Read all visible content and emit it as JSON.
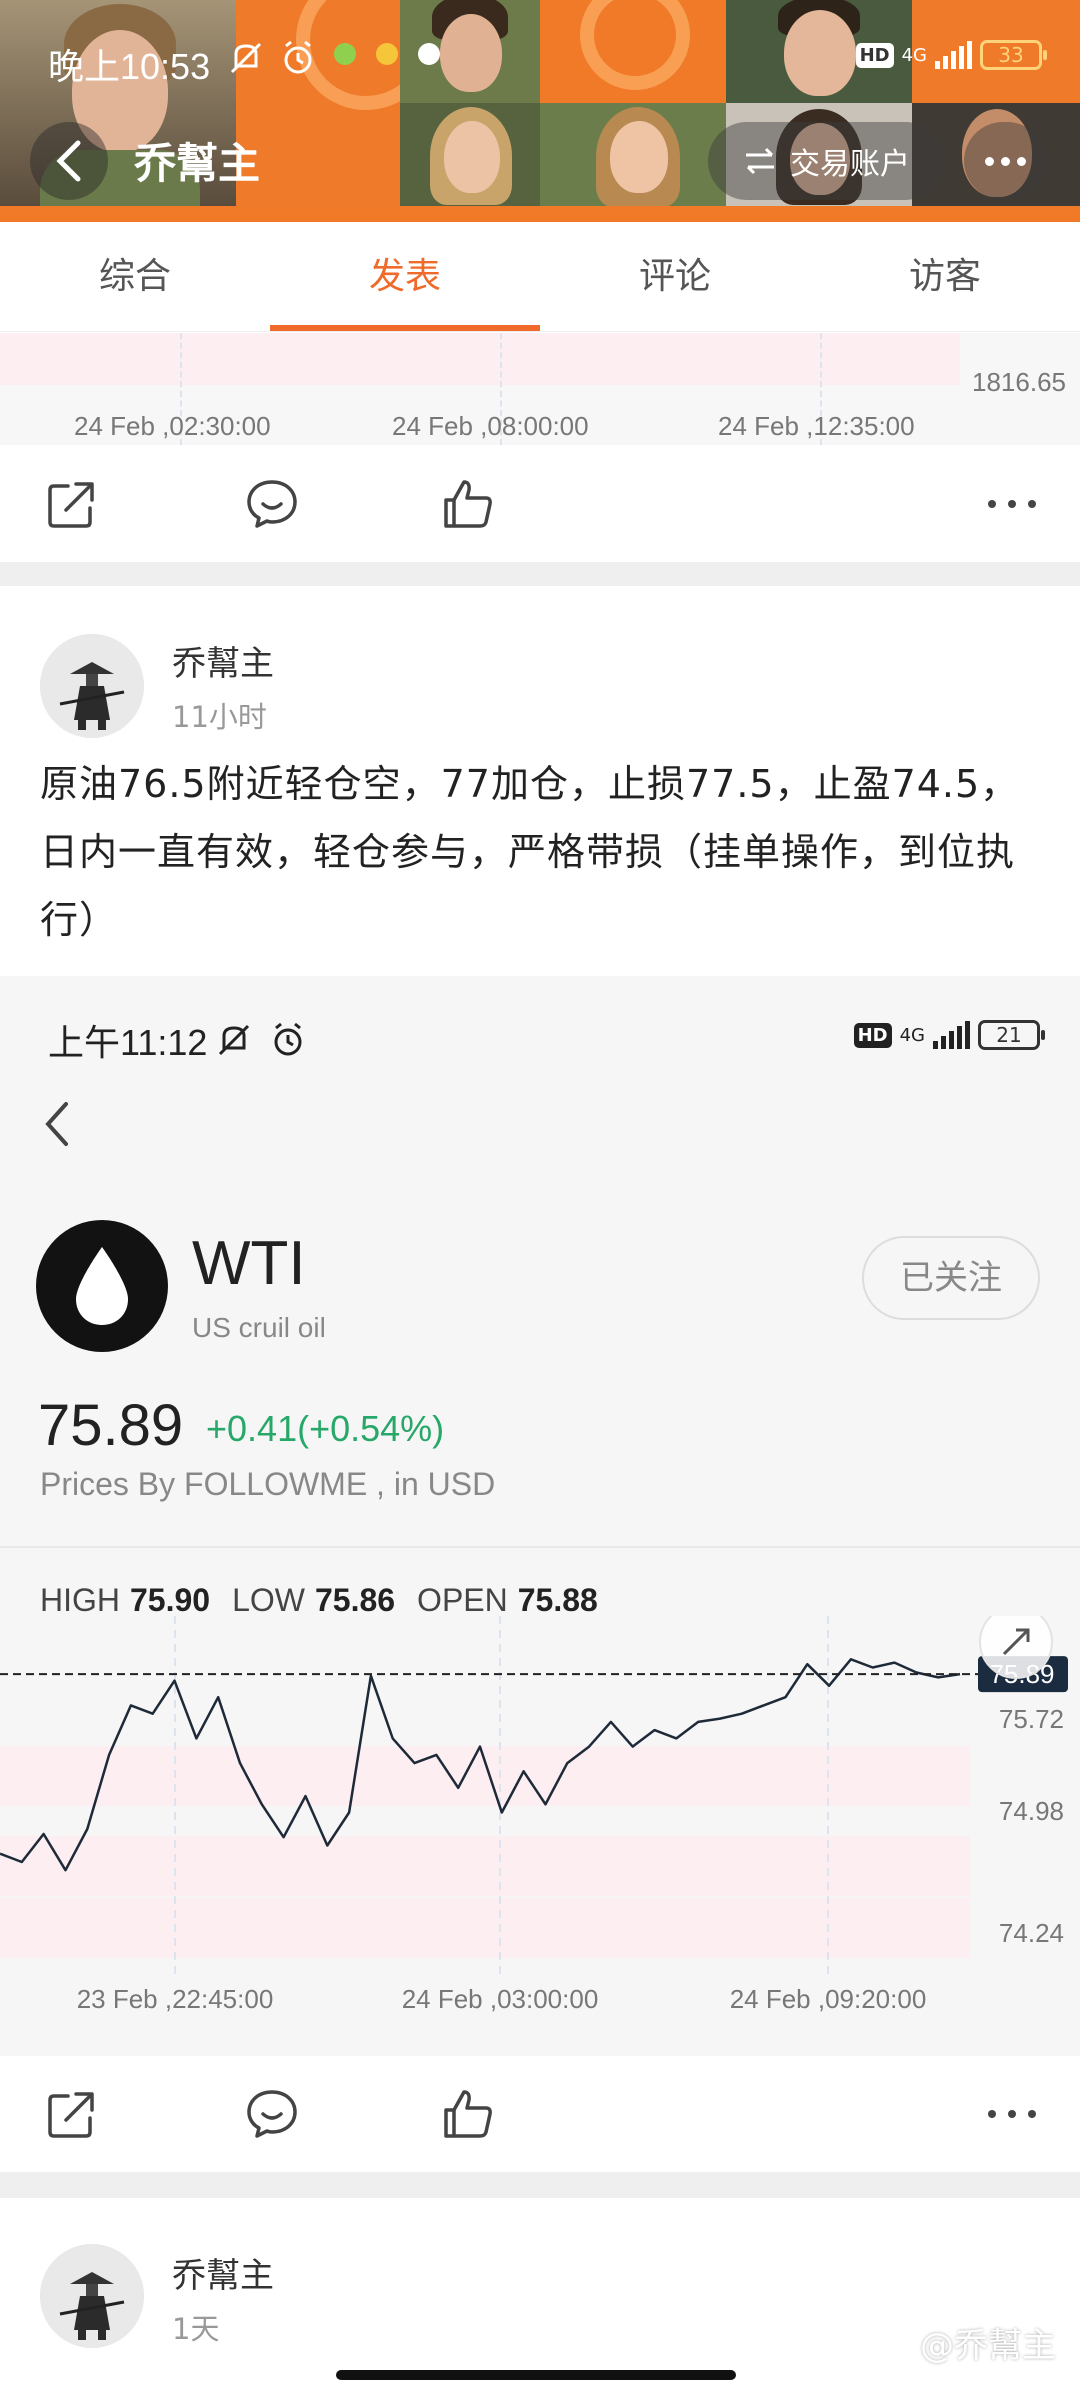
{
  "status_bar": {
    "time": "晚上10:53",
    "network": "4G",
    "battery": "33"
  },
  "nav": {
    "title": "乔幫主",
    "account_button": "交易账户"
  },
  "tabs": [
    {
      "label": "综合",
      "active": false
    },
    {
      "label": "发表",
      "active": true
    },
    {
      "label": "评论",
      "active": false
    },
    {
      "label": "访客",
      "active": false
    }
  ],
  "top_chart": {
    "y_label": "1816.65",
    "x_labels": [
      "24 Feb ,02:30:00",
      "24 Feb ,08:00:00",
      "24 Feb ,12:35:00"
    ]
  },
  "post": {
    "author": "乔幫主",
    "time": "11小时",
    "text": "原油76.5附近轻仓空，77加仓，止损77.5，止盈74.5，日内一直有效，轻仓参与，严格带损（挂单操作，到位执行）"
  },
  "embedded": {
    "status_time": "上午11:12",
    "network": "4G",
    "battery": "21",
    "symbol": "WTI",
    "name": "US cruil oil",
    "follow_label": "已关注",
    "price": "75.89",
    "change": "+0.41(+0.54%)",
    "source": "Prices By FOLLOWME , in USD",
    "high_label": "HIGH",
    "high": "75.90",
    "low_label": "LOW",
    "low": "75.86",
    "open_label": "OPEN",
    "open": "75.88",
    "current_tag": "75.89"
  },
  "chart_data": {
    "type": "line",
    "title": "",
    "x": [
      "23 Feb ,22:45:00",
      "24 Feb ,03:00:00",
      "24 Feb ,09:20:00"
    ],
    "y_ticks": [
      "75.72",
      "74.98",
      "74.24"
    ],
    "ylim": [
      74.24,
      76.0
    ],
    "current_value": 75.89,
    "series": [
      {
        "values": [
          74.8,
          74.75,
          74.92,
          74.7,
          74.95,
          75.4,
          75.7,
          75.65,
          75.85,
          75.5,
          75.75,
          75.35,
          75.1,
          74.9,
          75.15,
          74.85,
          75.05,
          75.88,
          75.5,
          75.35,
          75.4,
          75.2,
          75.45,
          75.05,
          75.3,
          75.1,
          75.35,
          75.45,
          75.6,
          75.45,
          75.55,
          75.5,
          75.6,
          75.62,
          75.65,
          75.7,
          75.75,
          75.95,
          75.82,
          75.98,
          75.93,
          75.96,
          75.9,
          75.87,
          75.89
        ]
      }
    ]
  },
  "second_post": {
    "author": "乔幫主",
    "time": "1天"
  },
  "watermark": "@乔幫主"
}
